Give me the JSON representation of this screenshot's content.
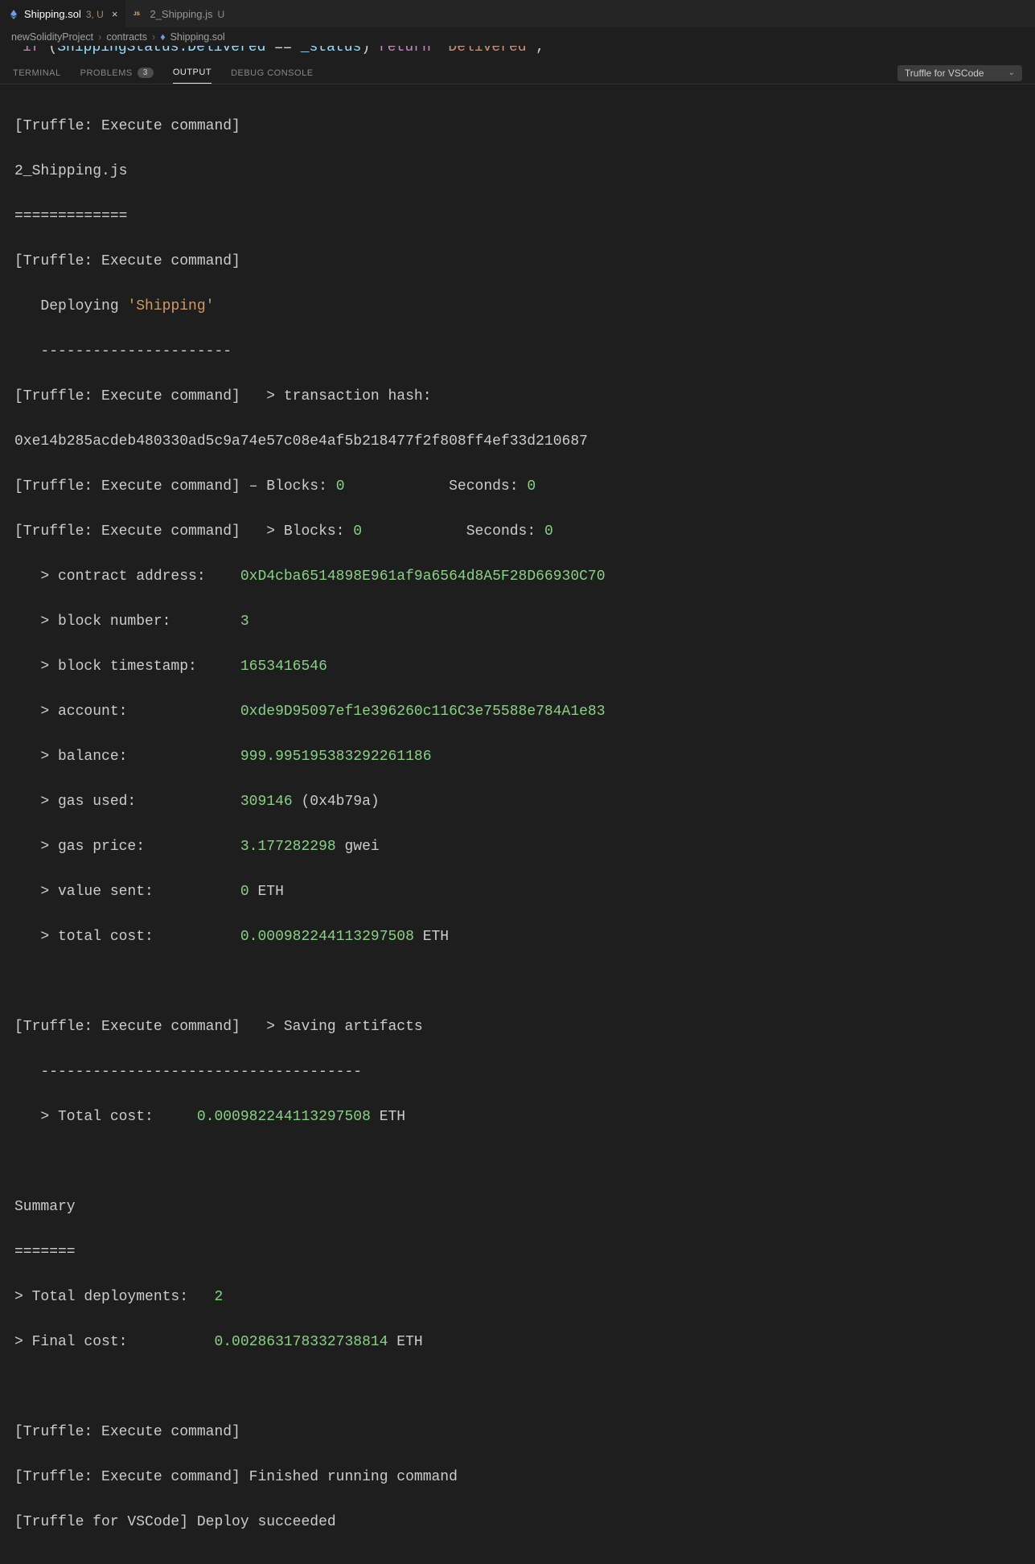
{
  "tabs": [
    {
      "icon": "ethereum-icon",
      "iconColor": "#6f9ee8",
      "label": "Shipping.sol",
      "mod": "3, U",
      "active": true,
      "closeable": true
    },
    {
      "icon": "js-icon",
      "iconColor": "#e2c26b",
      "label": "2_Shipping.js",
      "mod": "U",
      "active": false,
      "closeable": false
    }
  ],
  "breadcrumb": {
    "seg1": "newSolidityProject",
    "seg2": "contracts",
    "seg3icon": "ethereum-icon",
    "seg3": "Shipping.sol"
  },
  "editor_peek": {
    "kw_if": "if",
    "parenL": "(",
    "expr_enum": "ShippingStatus.Delivered",
    "expr_eq": "==",
    "expr_var": "_status",
    "parenR": ")",
    "kw_return": "return",
    "str": "\"Delivered\"",
    "semi": ";"
  },
  "panel_tabs": {
    "terminal": "TERMINAL",
    "problems": "PROBLEMS",
    "problems_badge": "3",
    "output": "OUTPUT",
    "debug": "DEBUG CONSOLE"
  },
  "dropdown_label": "Truffle for VSCode",
  "out": {
    "prefix": "[Truffle: Execute command]",
    "file": "2_Shipping.js",
    "rule_file": "=============",
    "deploying_lbl": "   Deploying ",
    "deploying_name": "'Shipping'",
    "rule_deploy": "   ----------------------",
    "txn_hash_lbl": "   > transaction hash:    ",
    "txn_hash_full": "0xe14b285acdeb480330ad5c9a74e57c08e4af5b218477f2f808ff4ef33d210687",
    "blocks_line1_pre": " – Blocks: ",
    "blocks_line1_zero1": "0",
    "blocks_line1_mid": "            Seconds: ",
    "blocks_line1_zero2": "0",
    "blocks_line2_pre": "   > Blocks: ",
    "blocks_line2_zero1": "0",
    "blocks_line2_mid": "            Seconds: ",
    "blocks_line2_zero2": "0",
    "lbl_contract_addr": "   > contract address:    ",
    "val_contract_addr": "0xD4cba6514898E961af9a6564d8A5F28D66930C70",
    "lbl_block_num": "   > block number:        ",
    "val_block_num": "3",
    "lbl_block_ts": "   > block timestamp:     ",
    "val_block_ts": "1653416546",
    "lbl_account": "   > account:             ",
    "val_account": "0xde9D95097ef1e396260c116C3e75588e784A1e83",
    "lbl_balance": "   > balance:             ",
    "val_balance": "999.995195383292261186",
    "lbl_gas_used": "   > gas used:            ",
    "val_gas_used": "309146",
    "val_gas_used_hex": " (0x4b79a)",
    "lbl_gas_price": "   > gas price:           ",
    "val_gas_price": "3.177282298",
    "unit_gwei": " gwei",
    "lbl_value_sent": "   > value sent:          ",
    "val_value_sent": "0",
    "unit_eth": " ETH",
    "lbl_total_cost": "   > total cost:          ",
    "val_total_cost": "0.000982244113297508",
    "saving_artifacts": "   > Saving artifacts",
    "rule_artifacts": "   -------------------------------------",
    "lbl_total_cost2": "   > Total cost:     ",
    "val_total_cost2": "0.000982244113297508",
    "summary": "Summary",
    "rule_summary": "=======",
    "lbl_total_deploy": "> Total deployments:   ",
    "val_total_deploy": "2",
    "lbl_final_cost": "> Final cost:          ",
    "val_final_cost": "0.002863178332738814",
    "finished": " Finished running command",
    "vscode_prefix": "[Truffle for VSCode]",
    "succeed": " Deploy succeeded"
  }
}
